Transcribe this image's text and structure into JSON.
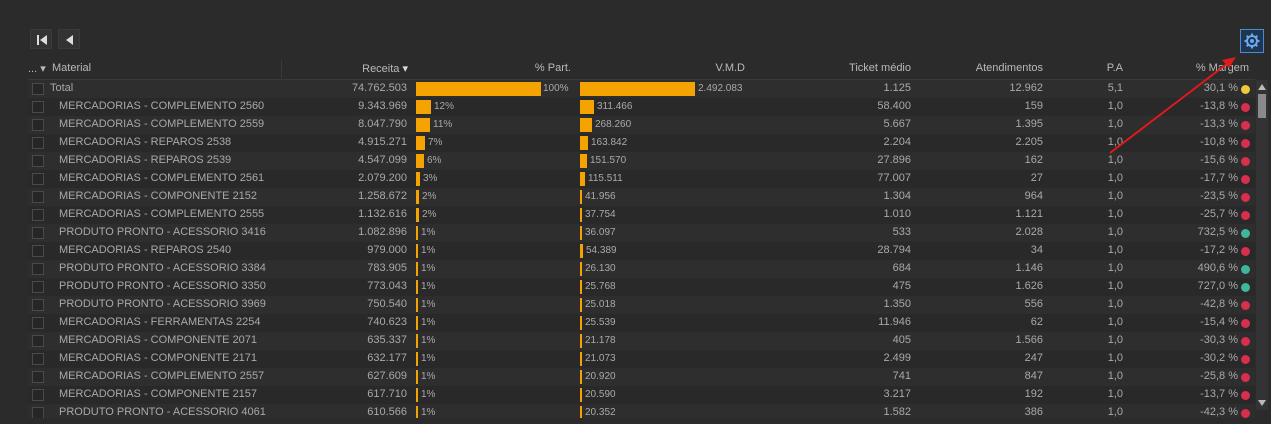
{
  "colors": {
    "bar": "#f5a300",
    "dot_yellow": "#f0c93a",
    "dot_red": "#d6304d",
    "dot_green": "#3fb59a",
    "accent": "#4a8bd6",
    "annotation": "#e0191d"
  },
  "toolbar": {
    "first_icon": "first-page-icon",
    "prev_icon": "previous-page-icon",
    "settings_icon": "gear-icon"
  },
  "header": {
    "expand": "...",
    "material": "Material",
    "receita": "Receita",
    "part": "% Part.",
    "vmd": "V.M.D",
    "ticket": "Ticket médio",
    "atend": "Atendimentos",
    "pa": "P.A",
    "margem": "% Margem"
  },
  "rows": [
    {
      "material": "Total",
      "receita": "74.762.503",
      "part": "100%",
      "part_val": 100,
      "vmd": "2.492.083",
      "vmd_val": 2492083,
      "ticket": "1.125",
      "atend": "12.962",
      "pa": "5,1",
      "margem": "30,1 %",
      "status": "yellow"
    },
    {
      "material": "MERCADORIAS - COMPLEMENTO 2560",
      "receita": "9.343.969",
      "part": "12%",
      "part_val": 12,
      "vmd": "311.466",
      "vmd_val": 311466,
      "ticket": "58.400",
      "atend": "159",
      "pa": "1,0",
      "margem": "-13,8 %",
      "status": "red"
    },
    {
      "material": "MERCADORIAS - COMPLEMENTO 2559",
      "receita": "8.047.790",
      "part": "11%",
      "part_val": 11,
      "vmd": "268.260",
      "vmd_val": 268260,
      "ticket": "5.667",
      "atend": "1.395",
      "pa": "1,0",
      "margem": "-13,3 %",
      "status": "red"
    },
    {
      "material": "MERCADORIAS - REPAROS 2538",
      "receita": "4.915.271",
      "part": "7%",
      "part_val": 7,
      "vmd": "163.842",
      "vmd_val": 163842,
      "ticket": "2.204",
      "atend": "2.205",
      "pa": "1,0",
      "margem": "-10,8 %",
      "status": "red"
    },
    {
      "material": "MERCADORIAS - REPAROS 2539",
      "receita": "4.547.099",
      "part": "6%",
      "part_val": 6,
      "vmd": "151.570",
      "vmd_val": 151570,
      "ticket": "27.896",
      "atend": "162",
      "pa": "1,0",
      "margem": "-15,6 %",
      "status": "red"
    },
    {
      "material": "MERCADORIAS - COMPLEMENTO 2561",
      "receita": "2.079.200",
      "part": "3%",
      "part_val": 3,
      "vmd": "115.511",
      "vmd_val": 115511,
      "ticket": "77.007",
      "atend": "27",
      "pa": "1,0",
      "margem": "-17,7 %",
      "status": "red"
    },
    {
      "material": "MERCADORIAS - COMPONENTE 2152",
      "receita": "1.258.672",
      "part": "2%",
      "part_val": 2,
      "vmd": "41.956",
      "vmd_val": 41956,
      "ticket": "1.304",
      "atend": "964",
      "pa": "1,0",
      "margem": "-23,5 %",
      "status": "red"
    },
    {
      "material": "MERCADORIAS - COMPLEMENTO 2555",
      "receita": "1.132.616",
      "part": "2%",
      "part_val": 2,
      "vmd": "37.754",
      "vmd_val": 37754,
      "ticket": "1.010",
      "atend": "1.121",
      "pa": "1,0",
      "margem": "-25,7 %",
      "status": "red"
    },
    {
      "material": "PRODUTO PRONTO - ACESSORIO 3416",
      "receita": "1.082.896",
      "part": "1%",
      "part_val": 1,
      "vmd": "36.097",
      "vmd_val": 36097,
      "ticket": "533",
      "atend": "2.028",
      "pa": "1,0",
      "margem": "732,5 %",
      "status": "green"
    },
    {
      "material": "MERCADORIAS - REPAROS 2540",
      "receita": "979.000",
      "part": "1%",
      "part_val": 1,
      "vmd": "54.389",
      "vmd_val": 54389,
      "ticket": "28.794",
      "atend": "34",
      "pa": "1,0",
      "margem": "-17,2 %",
      "status": "red"
    },
    {
      "material": "PRODUTO PRONTO - ACESSORIO 3384",
      "receita": "783.905",
      "part": "1%",
      "part_val": 1,
      "vmd": "26.130",
      "vmd_val": 26130,
      "ticket": "684",
      "atend": "1.146",
      "pa": "1,0",
      "margem": "490,6 %",
      "status": "green"
    },
    {
      "material": "PRODUTO PRONTO - ACESSORIO 3350",
      "receita": "773.043",
      "part": "1%",
      "part_val": 1,
      "vmd": "25.768",
      "vmd_val": 25768,
      "ticket": "475",
      "atend": "1.626",
      "pa": "1,0",
      "margem": "727,0 %",
      "status": "green"
    },
    {
      "material": "PRODUTO PRONTO - ACESSORIO 3969",
      "receita": "750.540",
      "part": "1%",
      "part_val": 1,
      "vmd": "25.018",
      "vmd_val": 25018,
      "ticket": "1.350",
      "atend": "556",
      "pa": "1,0",
      "margem": "-42,8 %",
      "status": "red"
    },
    {
      "material": "MERCADORIAS - FERRAMENTAS 2254",
      "receita": "740.623",
      "part": "1%",
      "part_val": 1,
      "vmd": "25.539",
      "vmd_val": 25539,
      "ticket": "11.946",
      "atend": "62",
      "pa": "1,0",
      "margem": "-15,4 %",
      "status": "red"
    },
    {
      "material": "MERCADORIAS - COMPONENTE 2071",
      "receita": "635.337",
      "part": "1%",
      "part_val": 1,
      "vmd": "21.178",
      "vmd_val": 21178,
      "ticket": "405",
      "atend": "1.566",
      "pa": "1,0",
      "margem": "-30,3 %",
      "status": "red"
    },
    {
      "material": "MERCADORIAS - COMPONENTE 2171",
      "receita": "632.177",
      "part": "1%",
      "part_val": 1,
      "vmd": "21.073",
      "vmd_val": 21073,
      "ticket": "2.499",
      "atend": "247",
      "pa": "1,0",
      "margem": "-30,2 %",
      "status": "red"
    },
    {
      "material": "MERCADORIAS - COMPLEMENTO 2557",
      "receita": "627.609",
      "part": "1%",
      "part_val": 1,
      "vmd": "20.920",
      "vmd_val": 20920,
      "ticket": "741",
      "atend": "847",
      "pa": "1,0",
      "margem": "-25,8 %",
      "status": "red"
    },
    {
      "material": "MERCADORIAS - COMPONENTE 2157",
      "receita": "617.710",
      "part": "1%",
      "part_val": 1,
      "vmd": "20.590",
      "vmd_val": 20590,
      "ticket": "3.217",
      "atend": "192",
      "pa": "1,0",
      "margem": "-13,7 %",
      "status": "red"
    },
    {
      "material": "PRODUTO PRONTO - ACESSORIO 4061",
      "receita": "610.566",
      "part": "1%",
      "part_val": 1,
      "vmd": "20.352",
      "vmd_val": 20352,
      "ticket": "1.582",
      "atend": "386",
      "pa": "1,0",
      "margem": "-42,3 %",
      "status": "red"
    }
  ]
}
